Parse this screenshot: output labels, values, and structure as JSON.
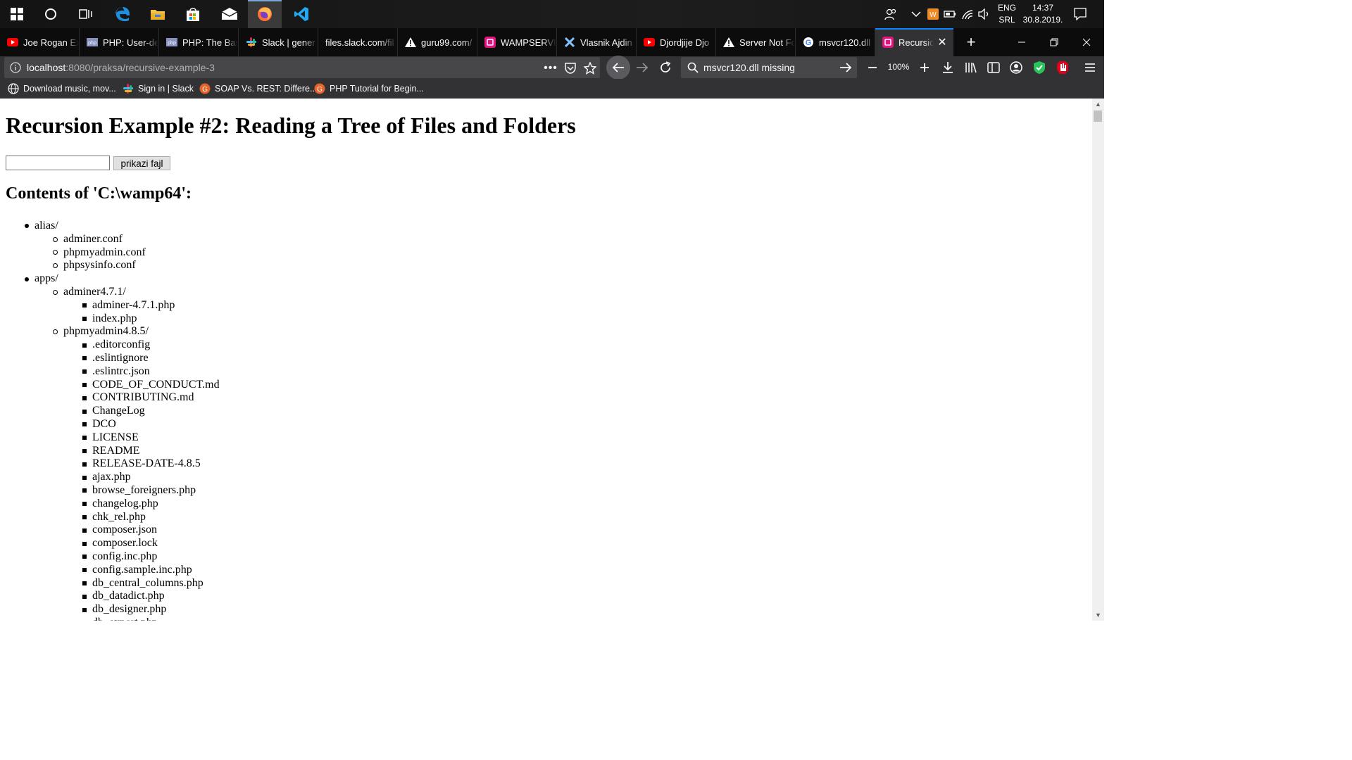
{
  "taskbar": {
    "apps": [
      {
        "name": "windows-start",
        "icon": "windows-logo-icon"
      },
      {
        "name": "cortana",
        "icon": "cortana-circle-icon"
      },
      {
        "name": "task-view",
        "icon": "task-view-icon"
      },
      {
        "name": "edge",
        "icon": "edge-icon"
      },
      {
        "name": "file-explorer",
        "icon": "folder-icon"
      },
      {
        "name": "store",
        "icon": "store-bag-icon"
      },
      {
        "name": "mail",
        "icon": "mail-icon"
      },
      {
        "name": "firefox",
        "icon": "firefox-icon"
      },
      {
        "name": "vscode",
        "icon": "vscode-icon"
      }
    ],
    "language": "ENG",
    "keyboard": "SRL",
    "time": "14:37",
    "date": "30.8.2019."
  },
  "tabs": [
    {
      "title": "Joe Rogan Ex",
      "favicon": "youtube-icon"
    },
    {
      "title": "PHP: User-de",
      "favicon": "php-icon"
    },
    {
      "title": "PHP: The Bas",
      "favicon": "php-icon"
    },
    {
      "title": "Slack | gener",
      "favicon": "slack-icon"
    },
    {
      "title": "files.slack.com/fil",
      "favicon": ""
    },
    {
      "title": "guru99.com/",
      "favicon": "warning-icon"
    },
    {
      "title": "WAMPSERVE",
      "favicon": "wamp-icon"
    },
    {
      "title": "Vlasnik Ajdin",
      "favicon": "x-logo-icon"
    },
    {
      "title": "Djordjije Djo",
      "favicon": "youtube-icon"
    },
    {
      "title": "Server Not Fo",
      "favicon": "warning-icon"
    },
    {
      "title": "msvcr120.dll",
      "favicon": "google-icon"
    },
    {
      "title": "Recursion",
      "favicon": "wamp-icon"
    }
  ],
  "navbar": {
    "url_host": "localhost",
    "url_path": ":8080/praksa/recursive-example-3",
    "search_text": "msvcr120.dll missing",
    "zoom": "100%"
  },
  "bookmarks": [
    {
      "label": "Download music, mov...",
      "icon": "globe-icon"
    },
    {
      "label": "Sign in | Slack",
      "icon": "slack-icon"
    },
    {
      "label": "SOAP Vs. REST: Differe...",
      "icon": "guru-icon"
    },
    {
      "label": "PHP Tutorial for Begin...",
      "icon": "guru-icon"
    }
  ],
  "page": {
    "heading": "Recursion Example #2: Reading a Tree of Files and Folders",
    "input_value": "",
    "button_label": "prikazi fajl",
    "contents_heading": "Contents of 'C:\\wamp64':",
    "tree": [
      {
        "level": 1,
        "text": "alias/"
      },
      {
        "level": 2,
        "text": "adminer.conf"
      },
      {
        "level": 2,
        "text": "phpmyadmin.conf"
      },
      {
        "level": 2,
        "text": "phpsysinfo.conf"
      },
      {
        "level": 1,
        "text": "apps/"
      },
      {
        "level": 2,
        "text": "adminer4.7.1/"
      },
      {
        "level": 3,
        "text": "adminer-4.7.1.php"
      },
      {
        "level": 3,
        "text": "index.php"
      },
      {
        "level": 2,
        "text": "phpmyadmin4.8.5/"
      },
      {
        "level": 3,
        "text": ".editorconfig"
      },
      {
        "level": 3,
        "text": ".eslintignore"
      },
      {
        "level": 3,
        "text": ".eslintrc.json"
      },
      {
        "level": 3,
        "text": "CODE_OF_CONDUCT.md"
      },
      {
        "level": 3,
        "text": "CONTRIBUTING.md"
      },
      {
        "level": 3,
        "text": "ChangeLog"
      },
      {
        "level": 3,
        "text": "DCO"
      },
      {
        "level": 3,
        "text": "LICENSE"
      },
      {
        "level": 3,
        "text": "README"
      },
      {
        "level": 3,
        "text": "RELEASE-DATE-4.8.5"
      },
      {
        "level": 3,
        "text": "ajax.php"
      },
      {
        "level": 3,
        "text": "browse_foreigners.php"
      },
      {
        "level": 3,
        "text": "changelog.php"
      },
      {
        "level": 3,
        "text": "chk_rel.php"
      },
      {
        "level": 3,
        "text": "composer.json"
      },
      {
        "level": 3,
        "text": "composer.lock"
      },
      {
        "level": 3,
        "text": "config.inc.php"
      },
      {
        "level": 3,
        "text": "config.sample.inc.php"
      },
      {
        "level": 3,
        "text": "db_central_columns.php"
      },
      {
        "level": 3,
        "text": "db_datadict.php"
      },
      {
        "level": 3,
        "text": "db_designer.php"
      },
      {
        "level": 3,
        "text": "db_export.php"
      }
    ]
  },
  "colors": {
    "taskbar": "#1a1a1a",
    "tabstrip": "#0c0c0d",
    "toolbar": "#323234",
    "accent": "#0a84ff",
    "page_bg": "#ffffff"
  }
}
